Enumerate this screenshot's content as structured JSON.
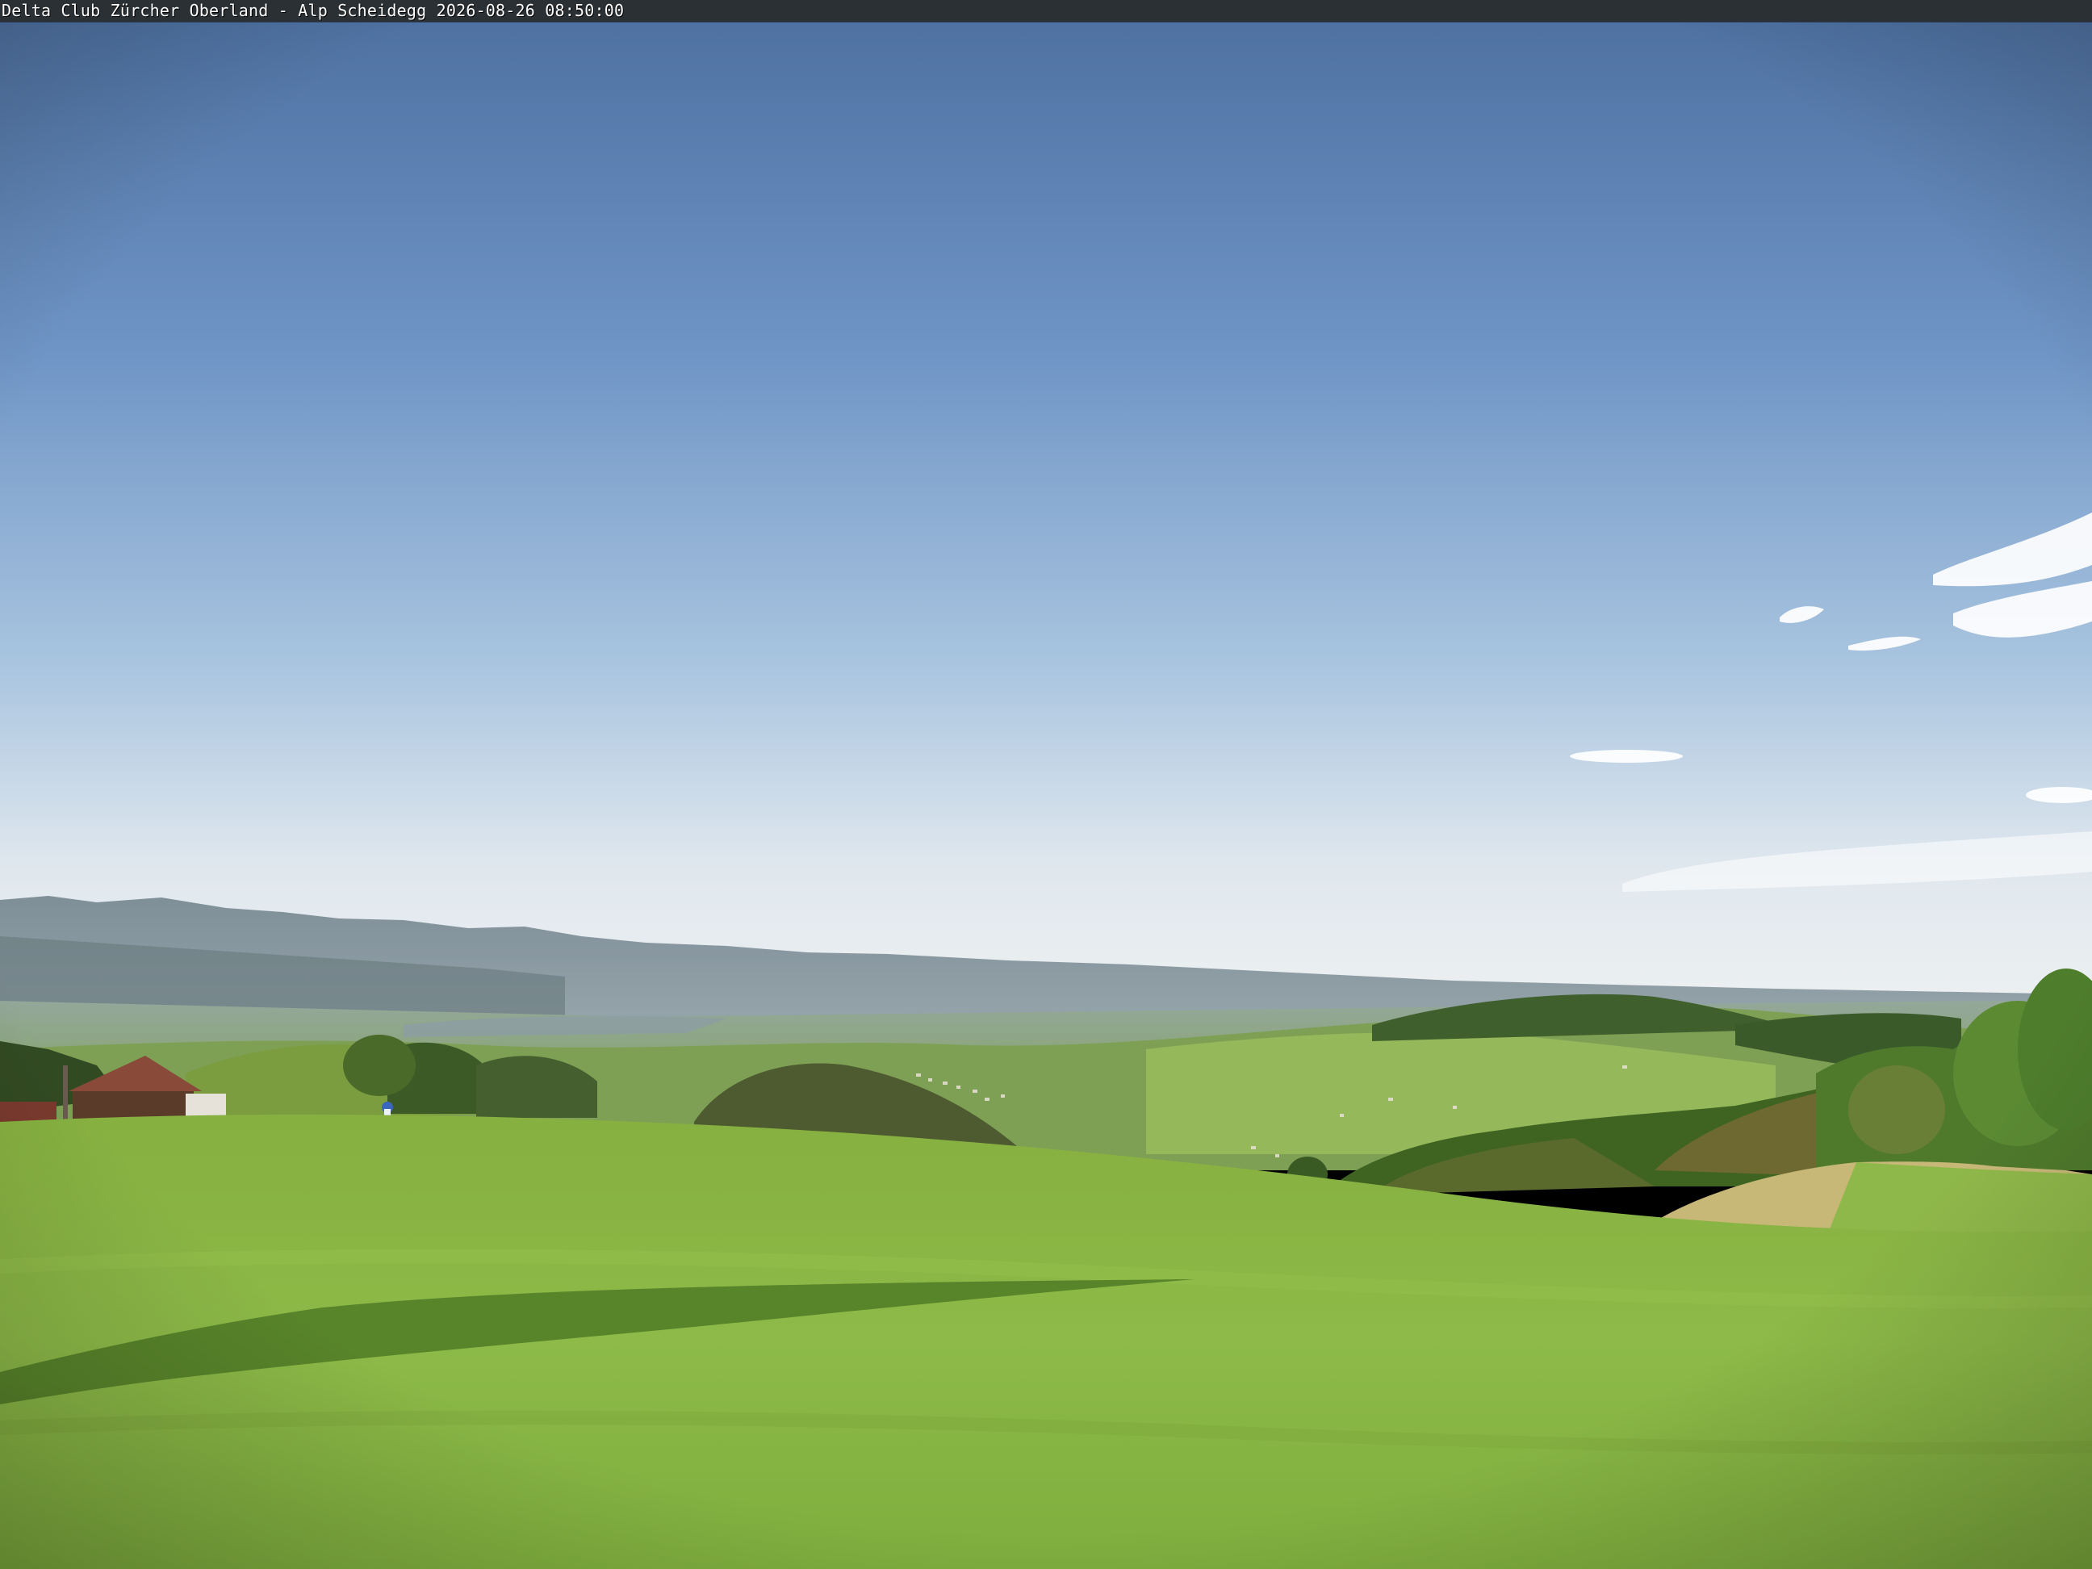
{
  "overlay": {
    "caption": "Delta Club Zürcher Oberland - Alp Scheidegg 2026-08-26 08:50:00"
  },
  "scene": {
    "sky_top_color": "#4a72a8",
    "sky_horizon_color": "#e8eef2",
    "meadow_color": "#8fbb45",
    "forest_color": "#3d6a22",
    "mountain_color": "#7d8f9a"
  }
}
